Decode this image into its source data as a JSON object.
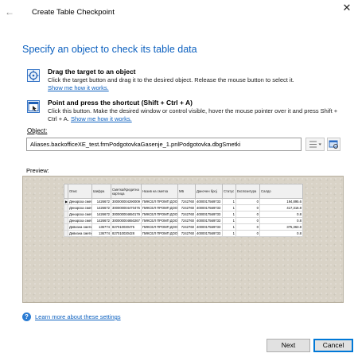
{
  "window": {
    "title": "Create Table Checkpoint",
    "back_glyph": "←",
    "close_glyph": "✕"
  },
  "heading": "Specify an object to check its table data",
  "options": [
    {
      "icon": "crosshair-target-icon",
      "title": "Drag the target to an object",
      "text": "Click the target button and drag it to the desired object. Release the mouse button to select it.",
      "link": "Show me how it works."
    },
    {
      "icon": "window-pointer-icon",
      "title": "Point and press the shortcut (Shift + Ctrl + A)",
      "text": "Click this button. Make the desired window or control visible, hover the mouse pointer over it and press Shift + Ctrl + A.",
      "link": "Show me how it works."
    }
  ],
  "object": {
    "label": "Object:",
    "value": "Aliases.backofficeXE_test.frmPodgotovkaGasenje_1.pnlPodgotovka.dbgSmetki"
  },
  "preview": {
    "label": "Preview:",
    "columns": [
      "",
      "Опис",
      "Шифра",
      "Сметка/Кредитна картица",
      "Назив на сметка",
      "МБ",
      "Даночен број",
      "Статус",
      "Експозитура",
      "Салдо"
    ],
    "rows": [
      [
        "▶",
        "Денарска сметка",
        "1426672",
        "300000004290009",
        "ПИКСЕЛ ПРОМП ДОО (",
        "7242760",
        "4000017569733",
        "1",
        "0",
        "194,895.6"
      ],
      [
        "",
        "Денарска сметка",
        "1426672",
        "300000004470475",
        "ПИКСЕЛ ПРОМП ДОО (",
        "7242760",
        "4000017569733",
        "1",
        "0",
        "417,316.8"
      ],
      [
        "",
        "Денарска сметка",
        "1426672",
        "300000004650179",
        "ПИКСЕЛ ПРОМП ДОО (",
        "7242760",
        "4000017569733",
        "1",
        "0",
        "0.8"
      ],
      [
        "",
        "Денарска сметка",
        "1426672",
        "300000004650267",
        "ПИКСЕЛ ПРОМП ДОО (",
        "7242760",
        "4000017569733",
        "1",
        "0",
        "0.8"
      ],
      [
        "",
        "Девизна сметка",
        "136774",
        "827010030475",
        "ПИКСЕЛ ПРОМП ДОО (",
        "7242760",
        "4000017569733",
        "1",
        "0",
        "375,363.8"
      ],
      [
        "",
        "Девизна сметка",
        "136774",
        "827010030428",
        "ПИКСЕЛ ПРОМП ДОО (",
        "7242760",
        "4000017569733",
        "1",
        "0",
        "0.8"
      ]
    ]
  },
  "help_link": "Learn more about these settings",
  "buttons": {
    "next": "Next",
    "cancel": "Cancel"
  },
  "colors": {
    "accent": "#0a5fbf",
    "preview_bg": "#d9d3c7"
  }
}
